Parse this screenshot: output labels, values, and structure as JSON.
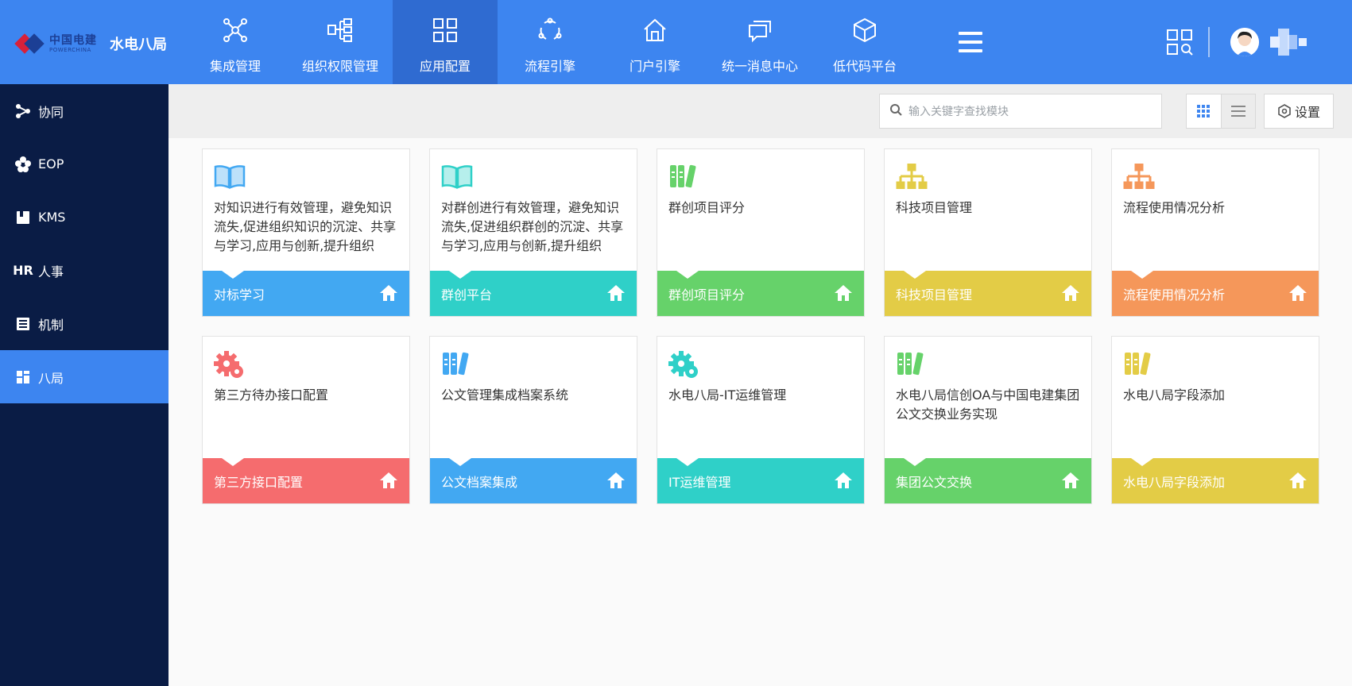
{
  "brand": {
    "logo_cn": "中国电建",
    "logo_en": "POWERCHINA",
    "subtitle": "水电八局"
  },
  "nav": [
    {
      "label": "集成管理",
      "icon": "network-icon"
    },
    {
      "label": "组织权限管理",
      "icon": "org-tree-icon"
    },
    {
      "label": "应用配置",
      "icon": "grid-icon",
      "active": true
    },
    {
      "label": "流程引擎",
      "icon": "cycle-icon"
    },
    {
      "label": "门户引擎",
      "icon": "home-icon"
    },
    {
      "label": "统一消息中心",
      "icon": "message-icon"
    },
    {
      "label": "低代码平台",
      "icon": "cube-icon"
    }
  ],
  "sidebar": [
    {
      "label": "协同",
      "icon": "share-icon"
    },
    {
      "label": "EOP",
      "icon": "flower-icon"
    },
    {
      "label": "KMS",
      "icon": "book-icon"
    },
    {
      "label": "人事",
      "icon": "hr-icon"
    },
    {
      "label": "机制",
      "icon": "document-list-icon"
    },
    {
      "label": "八局",
      "icon": "dashboard-icon",
      "active": true
    }
  ],
  "toolbar": {
    "search_placeholder": "输入关键字查找模块",
    "settings_label": "设置"
  },
  "colors": {
    "header": "#3d85f0",
    "sidebar": "#0a1c45",
    "blue": "#42a8f2",
    "teal": "#2fd0c8",
    "green": "#66d26a",
    "yellow": "#e3cc46",
    "orange": "#f5975a",
    "red": "#f56c6e"
  },
  "cards": [
    {
      "desc": "对知识进行有效管理，避免知识流失,促进组织知识的沉淀、共享与学习,应用与创新,提升组织",
      "title": "对标学习",
      "icon": "open-book-icon",
      "color": "#42a8f2",
      "icon_color": "#42a8f2"
    },
    {
      "desc": "对群创进行有效管理，避免知识流失,促进组织群创的沉淀、共享与学习,应用与创新,提升组织",
      "title": "群创平台",
      "icon": "open-book-icon",
      "color": "#2fd0c8",
      "icon_color": "#2fd0c8"
    },
    {
      "desc": "群创项目评分",
      "title": "群创项目评分",
      "icon": "books-icon",
      "color": "#66d26a",
      "icon_color": "#66d26a"
    },
    {
      "desc": "科技项目管理",
      "title": "科技项目管理",
      "icon": "hierarchy-icon",
      "color": "#e3cc46",
      "icon_color": "#e3cc46"
    },
    {
      "desc": "流程使用情况分析",
      "title": "流程使用情况分析",
      "icon": "hierarchy-icon",
      "color": "#f5975a",
      "icon_color": "#f5975a"
    },
    {
      "desc": "第三方待办接口配置",
      "title": "第三方接口配置",
      "icon": "gears-icon",
      "color": "#f56c6e",
      "icon_color": "#f56c6e"
    },
    {
      "desc": "公文管理集成档案系统",
      "title": "公文档案集成",
      "icon": "books-icon",
      "color": "#42a8f2",
      "icon_color": "#42a8f2"
    },
    {
      "desc": "水电八局-IT运维管理",
      "title": "IT运维管理",
      "icon": "gears-icon",
      "color": "#2fd0c8",
      "icon_color": "#2fd0c8"
    },
    {
      "desc": "水电八局信创OA与中国电建集团公文交换业务实现",
      "title": "集团公文交换",
      "icon": "books-icon",
      "color": "#66d26a",
      "icon_color": "#66d26a"
    },
    {
      "desc": "水电八局字段添加",
      "title": "水电八局字段添加",
      "icon": "books-icon",
      "color": "#e3cc46",
      "icon_color": "#e3cc46"
    }
  ]
}
